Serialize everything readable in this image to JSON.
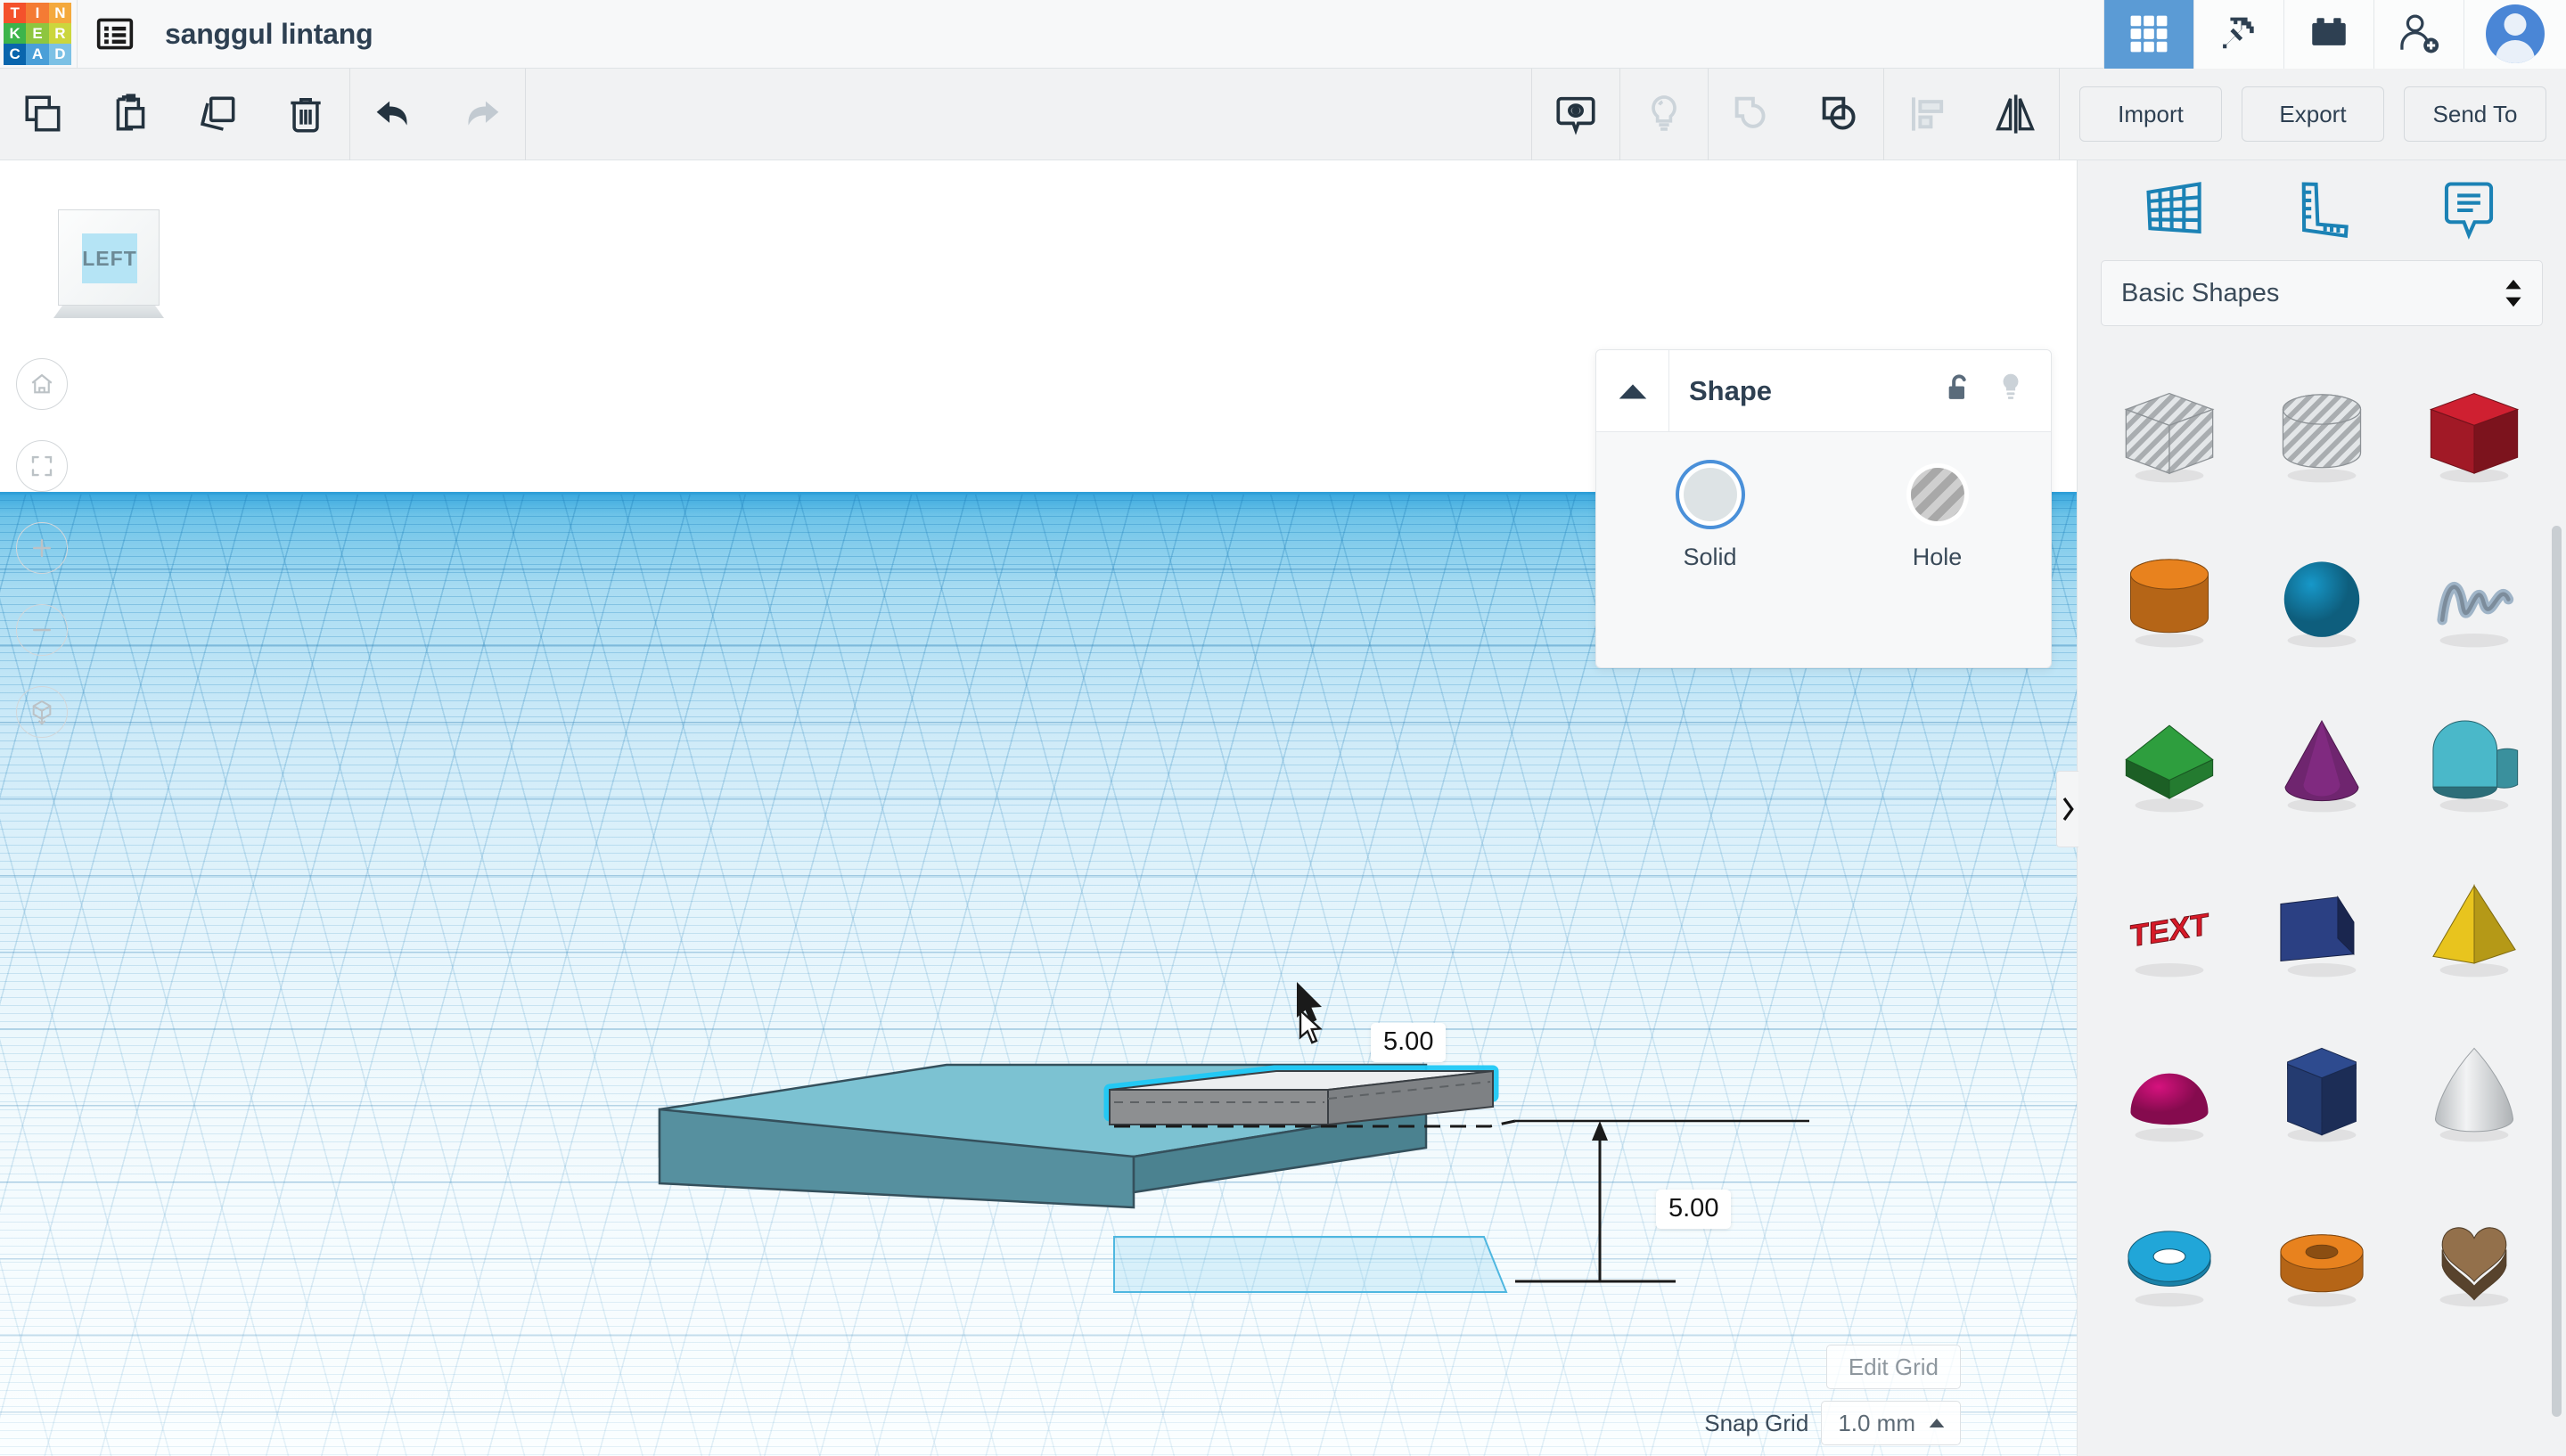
{
  "app": {
    "logo_letters": [
      {
        "ch": "T",
        "color": "#f4512c"
      },
      {
        "ch": "I",
        "color": "#f47b34"
      },
      {
        "ch": "N",
        "color": "#f4a93d"
      },
      {
        "ch": "K",
        "color": "#3cb44b"
      },
      {
        "ch": "E",
        "color": "#8ec63f"
      },
      {
        "ch": "R",
        "color": "#cbd63d"
      },
      {
        "ch": "C",
        "color": "#0a66ad"
      },
      {
        "ch": "A",
        "color": "#4a9fd8"
      },
      {
        "ch": "D",
        "color": "#7cc1e5"
      }
    ],
    "menu_icon": "list-menu-icon",
    "document_title": "sanggul lintang",
    "accent_blue": "#5b9bd5",
    "text_dark": "#2e4052"
  },
  "topbar_right": {
    "items": [
      {
        "name": "blocks-grid-icon",
        "label": "Blocks",
        "active": true
      },
      {
        "name": "pickaxe-icon",
        "label": "Minecraft",
        "active": false
      },
      {
        "name": "lego-brick-icon",
        "label": "Bricks",
        "active": false
      },
      {
        "name": "add-person-icon",
        "label": "Invite",
        "active": false
      }
    ],
    "avatar": "user-avatar"
  },
  "toolbar": {
    "left_tools": [
      {
        "name": "copy-icon",
        "label": "Copy",
        "enabled": true
      },
      {
        "name": "paste-icon",
        "label": "Paste",
        "enabled": true
      },
      {
        "name": "duplicate-icon",
        "label": "Duplicate",
        "enabled": true
      },
      {
        "name": "delete-icon",
        "label": "Delete",
        "enabled": true
      }
    ],
    "history_tools": [
      {
        "name": "undo-icon",
        "label": "Undo",
        "enabled": true
      },
      {
        "name": "redo-icon",
        "label": "Redo",
        "enabled": false
      }
    ],
    "right_tools": [
      {
        "name": "note-icon",
        "label": "Notes",
        "enabled": true
      },
      {
        "name": "lightbulb-icon",
        "label": "Lightbulb",
        "enabled": false
      },
      {
        "name": "group-icon",
        "label": "Group",
        "enabled": false
      },
      {
        "name": "ungroup-icon",
        "label": "Ungroup",
        "enabled": true
      },
      {
        "name": "align-icon",
        "label": "Align",
        "enabled": false
      },
      {
        "name": "mirror-icon",
        "label": "Mirror",
        "enabled": true
      }
    ],
    "import_label": "Import",
    "export_label": "Export",
    "send_to_label": "Send To"
  },
  "canvas": {
    "view_cube_label": "LEFT",
    "nav_buttons": [
      {
        "name": "home-view-icon",
        "label": "Home view"
      },
      {
        "name": "fit-all-icon",
        "label": "Fit all in view"
      },
      {
        "name": "zoom-in-icon",
        "label": "Zoom in"
      },
      {
        "name": "zoom-out-icon",
        "label": "Zoom out"
      },
      {
        "name": "orthographic-toggle-icon",
        "label": "Switch to orthographic/perspective view"
      }
    ],
    "dimension_top": "5.00",
    "dimension_height": "5.00",
    "edit_grid_label": "Edit Grid",
    "snap_grid_label": "Snap Grid",
    "snap_grid_value": "1.0 mm",
    "shapes": [
      {
        "name": "teal-box",
        "color": "#4f8694",
        "top_color": "#76bbcd"
      },
      {
        "name": "gray-box-selected",
        "color": "#8c8c8c",
        "top_color": "#e9eaeb",
        "highlight": "#1ec3f0"
      }
    ]
  },
  "shape_panel": {
    "title": "Shape",
    "collapse_icon": "triangle-up-icon",
    "lock_icon": "unlock-icon",
    "light_icon": "lightbulb-icon",
    "options": [
      {
        "name": "solid-option",
        "label": "Solid",
        "selected": true
      },
      {
        "name": "hole-option",
        "label": "Hole",
        "selected": false
      }
    ]
  },
  "sidebar": {
    "tabs": [
      {
        "name": "tab-shapes-grid",
        "label": "Shapes",
        "icon": "grid-plane-icon"
      },
      {
        "name": "tab-ruler",
        "label": "Ruler",
        "icon": "ruler-icon"
      },
      {
        "name": "tab-notes",
        "label": "Notes",
        "icon": "note-callout-icon"
      }
    ],
    "category_label": "Basic Shapes",
    "collapse_handle": "chevron-right-icon",
    "shapes": [
      {
        "name": "shape-box-hole",
        "label": "Box (hole)",
        "kind": "cube",
        "color": "#c9cdd0",
        "hole": true
      },
      {
        "name": "shape-cylinder-hole",
        "label": "Cylinder (hole)",
        "kind": "cylinder",
        "color": "#c9cdd0",
        "hole": true
      },
      {
        "name": "shape-box",
        "label": "Box",
        "kind": "cube",
        "color": "#cf2031",
        "hole": false
      },
      {
        "name": "shape-cylinder",
        "label": "Cylinder",
        "kind": "cylinder",
        "color": "#e8821e",
        "hole": false
      },
      {
        "name": "shape-sphere",
        "label": "Sphere",
        "kind": "sphere",
        "color": "#1798c9",
        "hole": false
      },
      {
        "name": "shape-scribble",
        "label": "Scribble",
        "kind": "scribble",
        "color": "#9fb4c7",
        "hole": false
      },
      {
        "name": "shape-roof",
        "label": "Roof",
        "kind": "roof",
        "color": "#2e9e3e",
        "hole": false
      },
      {
        "name": "shape-cone",
        "label": "Cone",
        "kind": "cone",
        "color": "#8e2f8e",
        "hole": false
      },
      {
        "name": "shape-half-cylinder",
        "label": "Half Cylinder",
        "kind": "halfcyl",
        "color": "#4ab8c9",
        "hole": false
      },
      {
        "name": "shape-text",
        "label": "Text",
        "kind": "text",
        "color": "#d71a28",
        "hole": false
      },
      {
        "name": "shape-wedge",
        "label": "Wedge",
        "kind": "wedge",
        "color": "#2b4083",
        "hole": false
      },
      {
        "name": "shape-pyramid",
        "label": "Pyramid",
        "kind": "pyramid",
        "color": "#e8c41e",
        "hole": false
      },
      {
        "name": "shape-hemisphere",
        "label": "Hemisphere",
        "kind": "hemi",
        "color": "#d6127e",
        "hole": false
      },
      {
        "name": "shape-polygon",
        "label": "Polygon",
        "kind": "hexprism",
        "color": "#2e4b8f",
        "hole": false
      },
      {
        "name": "shape-paraboloid",
        "label": "Paraboloid",
        "kind": "parab",
        "color": "#d9dcde",
        "hole": false
      },
      {
        "name": "shape-torus",
        "label": "Torus",
        "kind": "torus",
        "color": "#21a6d8",
        "hole": false
      },
      {
        "name": "shape-tube",
        "label": "Tube",
        "kind": "tube",
        "color": "#e8821e",
        "hole": false
      },
      {
        "name": "shape-heart",
        "label": "Heart",
        "kind": "heart",
        "color": "#93704b",
        "hole": false
      }
    ]
  }
}
